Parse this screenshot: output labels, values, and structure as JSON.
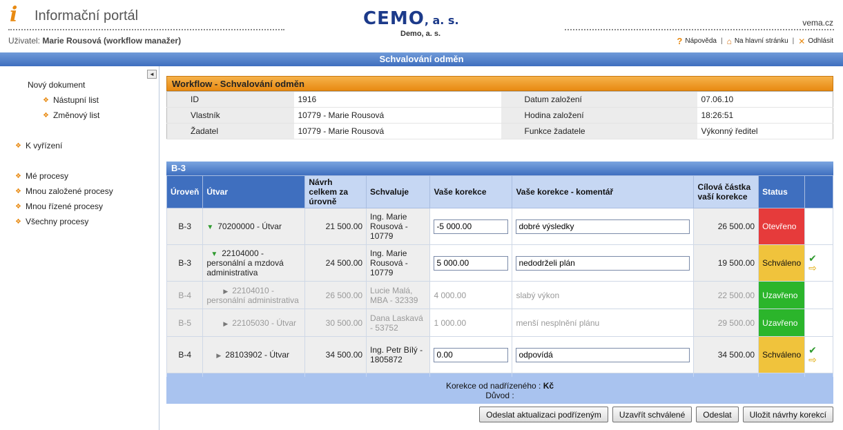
{
  "header": {
    "app_title": "Informační portál",
    "user_label": "Uživatel:",
    "user_name": "Marie Rousová (workflow manažer)",
    "company_logo": "CEMO",
    "company_logo_suffix": ", a. s.",
    "company_sub": "Demo, a. s.",
    "site": "vema.cz",
    "links": {
      "help": "Nápověda",
      "home": "Na hlavní stránku",
      "logout": "Odhlásit"
    }
  },
  "page_title": "Schvalování odměn",
  "sidebar": {
    "collapse": "◄",
    "new_doc": "Nový dokument",
    "nastupni": "Nástupní list",
    "zmenovy": "Změnový list",
    "k_vyrizeni": "K vyřízení",
    "me_procesy": "Mé procesy",
    "mnou_zalozene": "Mnou založené procesy",
    "mnou_rizene": "Mnou řízené procesy",
    "vsechny": "Všechny procesy"
  },
  "workflow": {
    "title": "Workflow - Schvalování odměn",
    "rows": [
      {
        "l1": "ID",
        "v1": "1916",
        "l2": "Datum založení",
        "v2": "07.06.10"
      },
      {
        "l1": "Vlastník",
        "v1": "10779 - Marie Rousová",
        "l2": "Hodina založení",
        "v2": "18:26:51"
      },
      {
        "l1": "Žadatel",
        "v1": "10779 - Marie Rousová",
        "l2": "Funkce žadatele",
        "v2": "Výkonný ředitel"
      }
    ]
  },
  "grid": {
    "title": "B-3",
    "headers": {
      "uroven": "Úroveň",
      "utvar": "Útvar",
      "navrh": "Návrh celkem za úrovně",
      "schvaluje": "Schvaluje",
      "korekce": "Vaše korekce",
      "komentar": "Vaše korekce - komentář",
      "cilova": "Cílová částka vaší korekce",
      "status": "Status"
    },
    "rows": [
      {
        "level": "B-3",
        "unit": "70200000 - Útvar",
        "proposal": "21 500.00",
        "approver": "Ing. Marie Rousová - 10779",
        "correction": "-5 000.00",
        "comment": "dobré výsledky",
        "target": "26 500.00",
        "status": "Otevřeno"
      },
      {
        "level": "B-3",
        "unit": "22104000 - personální a mzdová administrativa",
        "proposal": "24 500.00",
        "approver": "Ing. Marie Rousová - 10779",
        "correction": "5 000.00",
        "comment": "nedodrželi plán",
        "target": "19 500.00",
        "status": "Schváleno"
      },
      {
        "level": "B-4",
        "unit": "22104010 - personální administrativa",
        "proposal": "26 500.00",
        "approver": "Lucie Malá, MBA - 32339",
        "correction": "4 000.00",
        "comment": "slabý výkon",
        "target": "22 500.00",
        "status": "Uzavřeno"
      },
      {
        "level": "B-5",
        "unit": "22105030 - Útvar",
        "proposal": "30 500.00",
        "approver": "Dana Laskavá - 53752",
        "correction": "1 000.00",
        "comment": "menší nesplnění plánu",
        "target": "29 500.00",
        "status": "Uzavřeno"
      },
      {
        "level": "B-4",
        "unit": "28103902 - Útvar",
        "proposal": "34 500.00",
        "approver": "Ing. Petr Bílý - 1805872",
        "correction": "0.00",
        "comment": "odpovídá",
        "target": "34 500.00",
        "status": "Schváleno"
      }
    ]
  },
  "footer": {
    "korekce_label": "Korekce od nadřízeného :",
    "korekce_value": "Kč",
    "duvod_label": "Důvod :"
  },
  "buttons": {
    "send_update": "Odeslat aktualizaci podřízeným",
    "close_approved": "Uzavřít schválené",
    "send": "Odeslat",
    "save": "Uložit návrhy korekcí"
  },
  "icons": {
    "triangle_down": "▼",
    "triangle_right": "▶",
    "check": "✔",
    "arrow": "⇨",
    "question": "?",
    "home": "⌂",
    "close": "✕",
    "bullet": "❖",
    "info": "i"
  }
}
